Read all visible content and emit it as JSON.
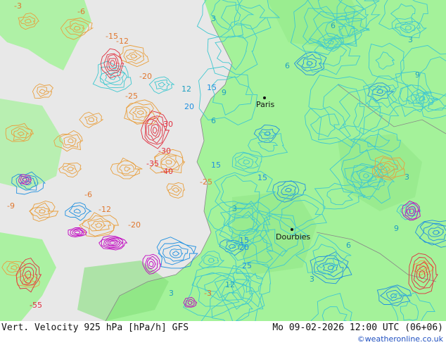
{
  "map": {
    "cities": [
      {
        "name": "Paris"
      },
      {
        "name": "Dourbies"
      }
    ],
    "contour_labels_positive": [
      "3",
      "3",
      "6",
      "6",
      "9",
      "12",
      "15",
      "15",
      "15",
      "20",
      "20",
      "25",
      "3",
      "6",
      "3",
      "9",
      "3",
      "3",
      "6",
      "9",
      "12",
      "15"
    ],
    "contour_labels_negative": [
      "-3",
      "-6",
      "-12",
      "-15",
      "-20",
      "-25",
      "-30",
      "-30",
      "-35",
      "-40",
      "-55",
      "-12",
      "-20",
      "-25",
      "-6",
      "-3",
      "-9"
    ],
    "colors": {
      "land": "#a4f29a",
      "land_dark": "#86e07c",
      "sea": "#e8e8e8",
      "positive_contour": "#2090e0",
      "positive_contour_light": "#40c8d0",
      "negative_contour": "#e8a040",
      "negative_contour_strong": "#e03040",
      "strong_negative": "#c000c0"
    }
  },
  "footer": {
    "title": "Vert. Velocity 925 hPa [hPa/h] GFS",
    "datetime": "Mo 09-02-2026 12:00 UTC (06+06)",
    "credit": "©weatheronline.co.uk"
  }
}
